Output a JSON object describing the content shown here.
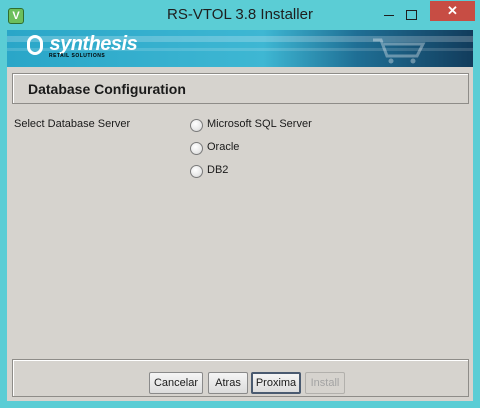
{
  "window": {
    "title": "RS-VTOL 3.8 Installer",
    "app_icon_glyph": "V",
    "close_glyph": "✕"
  },
  "banner": {
    "logo_name": "synthesis",
    "logo_tagline": "RETAIL SOLUTIONS"
  },
  "page": {
    "title": "Database Configuration",
    "server_label": "Select Database Server",
    "options": [
      {
        "label": "Microsoft SQL Server",
        "selected": false
      },
      {
        "label": "Oracle",
        "selected": false
      },
      {
        "label": "DB2",
        "selected": false
      }
    ]
  },
  "footer": {
    "cancel_label": "Cancelar",
    "back_label": "Atras",
    "next_label": "Proxima",
    "install_label": "Install"
  },
  "colors": {
    "title_bar": "#5bcdd5",
    "close_button": "#c74d44",
    "dialog_background": "#d6d3ce",
    "banner_accent": "#2aa6c8"
  }
}
